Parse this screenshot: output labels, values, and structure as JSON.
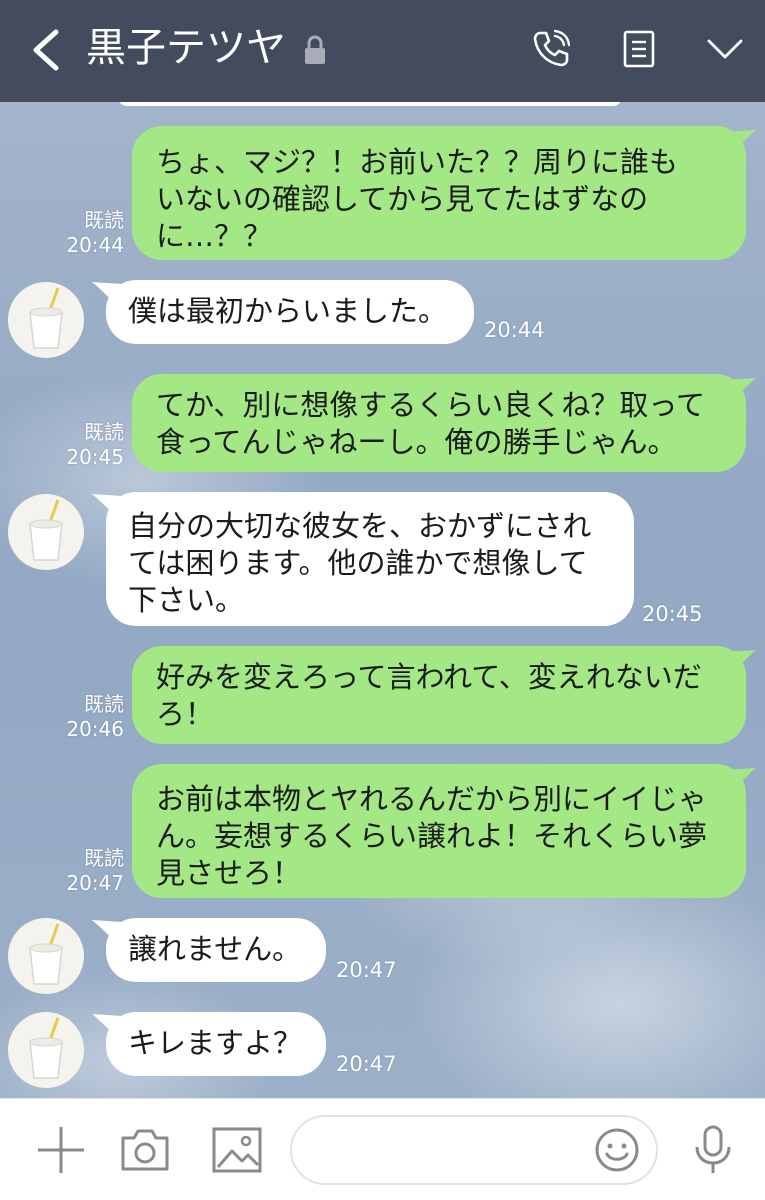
{
  "header": {
    "contact_name": "黒子テツヤ",
    "background_color": "#434b5f"
  },
  "read_label": "既読",
  "messages": [
    {
      "side": "out",
      "lines": [
        "ちょ、マジ？！お前いた？？周りに誰も",
        "いないの確認してから見てたはずなの",
        "に…？？"
      ],
      "time": "20:44"
    },
    {
      "side": "in",
      "lines": [
        "僕は最初からいました。"
      ],
      "time": "20:44"
    },
    {
      "side": "out",
      "lines": [
        "てか、別に想像するくらい良くね？取って",
        "食ってんじゃねーし。俺の勝手じゃん。"
      ],
      "time": "20:45"
    },
    {
      "side": "in",
      "lines": [
        "自分の大切な彼女を、おかずにされ",
        "ては困ります。他の誰かで想像して",
        "下さい。"
      ],
      "time": "20:45"
    },
    {
      "side": "out",
      "lines": [
        "好みを変えろって言われて、変えれないだ",
        "ろ！"
      ],
      "time": "20:46"
    },
    {
      "side": "out",
      "lines": [
        "お前は本物とヤれるんだから別にイイじゃ",
        "ん。妄想するくらい譲れよ！それくらい夢",
        "見させろ！"
      ],
      "time": "20:47"
    },
    {
      "side": "in",
      "lines": [
        "譲れません。"
      ],
      "time": "20:47"
    },
    {
      "side": "in",
      "lines": [
        "キレますよ？"
      ],
      "time": "20:47"
    }
  ],
  "colors": {
    "outgoing_bubble": "#a4e785",
    "incoming_bubble": "#ffffff",
    "accent_green": "#a4e785"
  },
  "icons": {
    "header": [
      "back-arrow-icon",
      "lock-icon",
      "phone-icon",
      "notes-icon",
      "chevron-down-icon"
    ],
    "input_bar": [
      "plus-icon",
      "camera-icon",
      "image-icon",
      "emoji-icon",
      "microphone-icon"
    ],
    "avatar": "milkshake-cup-avatar"
  }
}
